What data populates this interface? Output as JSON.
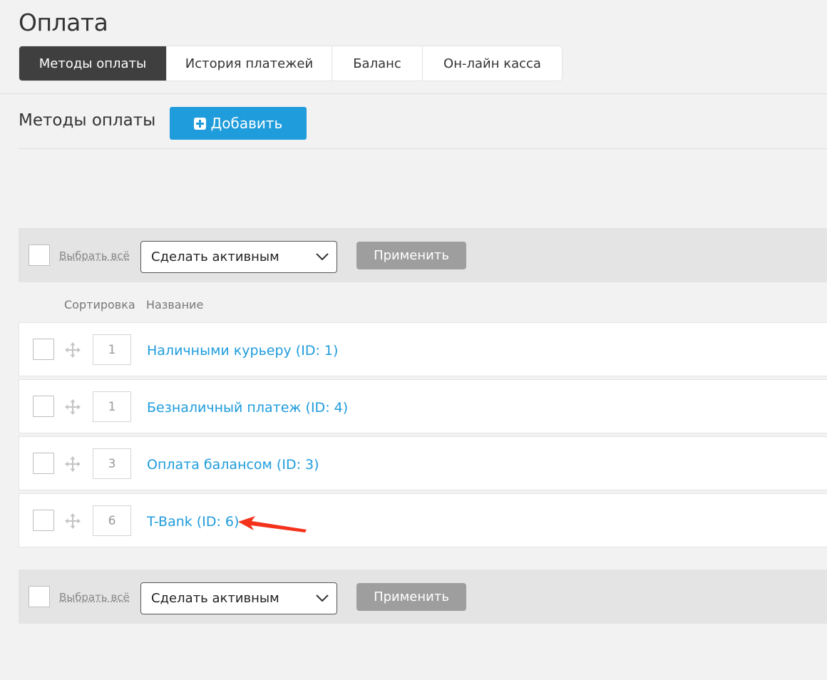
{
  "page": {
    "title": "Оплата"
  },
  "tabs": [
    {
      "label": "Методы оплаты",
      "active": true
    },
    {
      "label": "История платежей",
      "active": false
    },
    {
      "label": "Баланс",
      "active": false
    },
    {
      "label": "Он-лайн касса",
      "active": false
    }
  ],
  "section": {
    "title": "Методы оплаты",
    "add_label": "Добавить",
    "add_icon": "plus-square-icon"
  },
  "bulk_actions": {
    "select_all_label": "Выбрать всё",
    "action_value": "Сделать активным",
    "apply_label": "Применить"
  },
  "table": {
    "columns": {
      "sort": "Сортировка",
      "name": "Название"
    },
    "rows": [
      {
        "sort": "1",
        "name": "Наличными курьеру (ID: 1)"
      },
      {
        "sort": "1",
        "name": "Безналичный платеж (ID: 4)"
      },
      {
        "sort": "3",
        "name": "Оплата балансом (ID: 3)"
      },
      {
        "sort": "6",
        "name": "T-Bank (ID: 6)"
      }
    ]
  },
  "colors": {
    "accent": "#1f9cdc",
    "active_tab": "#3f3f3f",
    "annotation_arrow": "#f4321c",
    "apply_button": "#9e9e9e"
  }
}
